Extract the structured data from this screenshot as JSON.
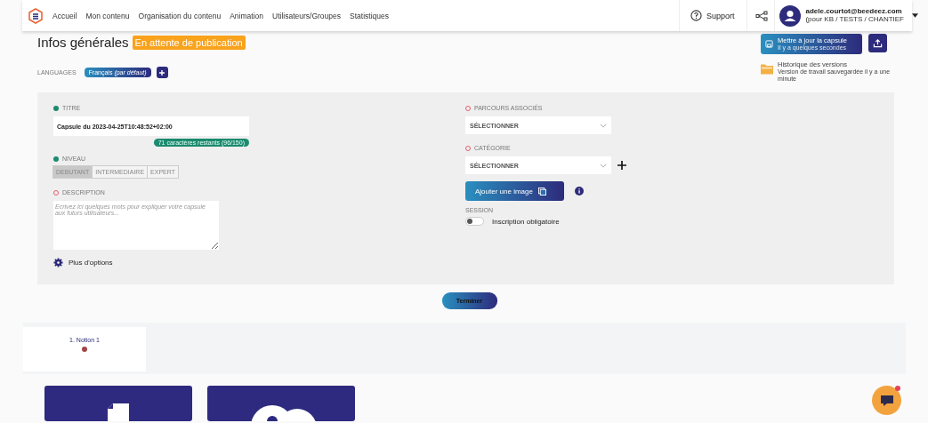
{
  "nav": {
    "items": [
      "Accueil",
      "Mon contenu",
      "Organisation du contenu",
      "Animation",
      "Utilisateurs/Groupes",
      "Statistiques"
    ],
    "support": "Support",
    "user": {
      "email": "adele.courtot@beedeez.com",
      "org": "(pour KB / TESTS / CHANTIEF"
    }
  },
  "header": {
    "title": "Infos générales",
    "status": "En attente de publication"
  },
  "languages": {
    "label": "LANGUAGES",
    "items": [
      {
        "name": "Français",
        "note": "(par défaut)",
        "selected": true
      }
    ]
  },
  "actions": {
    "update": {
      "label": "Mettre à jour la capsule",
      "sub": "Il y a quelques secondes"
    },
    "history": {
      "title": "Historique des versions",
      "text": "Version de travail sauvegardée il y a une minute"
    }
  },
  "form": {
    "title": {
      "label": "TITRE",
      "valid": true,
      "value": "Capsule du 2023-04-25T10:48:52+02:00",
      "counter": "71 caractères restants (96/150)"
    },
    "level": {
      "label": "NIVEAU",
      "valid": true,
      "options": [
        {
          "label": "DEBUTANT",
          "selected": true
        },
        {
          "label": "INTERMEDIAIRE",
          "selected": false
        },
        {
          "label": "EXPERT",
          "selected": false
        }
      ]
    },
    "description": {
      "label": "DESCRIPTION",
      "valid": false,
      "placeholder": "Ecrivez ici quelques mots pour expliquer votre capsule aux futurs utilisateurs..."
    },
    "more": "Plus d'options",
    "paths": {
      "label": "PARCOURS ASSOCIÉS",
      "valid": false,
      "value": "SÉLECTIONNER"
    },
    "category": {
      "label": "CATÉGORIE",
      "valid": false,
      "value": "SÉLECTIONNER"
    },
    "image_button": "Ajouter une image",
    "session": {
      "label": "SESSION",
      "toggle": "Inscription obligatoire",
      "on": false
    }
  },
  "finish": "Terminer",
  "notions": [
    {
      "label": "1. Notion 1",
      "selected": true
    }
  ]
}
